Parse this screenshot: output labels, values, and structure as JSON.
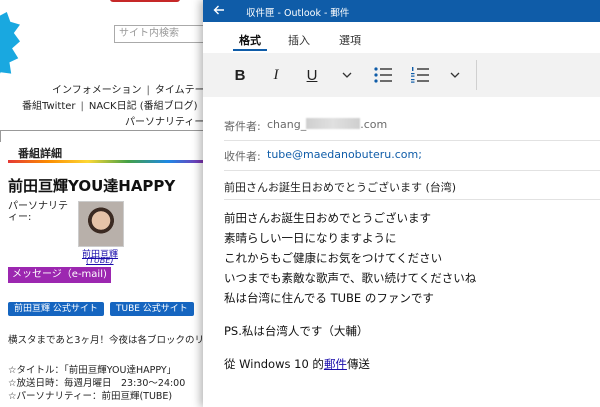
{
  "webpage": {
    "search_placeholder": "サイト内検索",
    "nav": {
      "row1": [
        "インフォメーション",
        "タイムテーブ"
      ],
      "row2": [
        "番組Twitter",
        "NACK日記 (番組ブログ)"
      ],
      "row3": [
        "パーソナリティー"
      ]
    },
    "section_title": "番組詳細",
    "program_title": "前田亘輝YOU達HAPPY",
    "personality_label": "パーソナリティー:",
    "host_name": "前田亘輝",
    "host_group": "(TUBE)",
    "message_button": "メッセージ（e-mail)",
    "site_buttons": [
      "前田亘輝 公式サイト",
      "TUBE 公式サイト"
    ],
    "intro_text": "横スタまであと3ヶ月！今夜は各ブロックのリ",
    "details": [
      "☆タイトル：「前田亘輝YOU達HAPPY」",
      "☆放送日時：毎週月曜日　23:30～24:00",
      "☆パーソナリティー：前田亘輝(TUBE)"
    ],
    "colors": {
      "badge": "#19a8e0",
      "message_button": "#9c27b0",
      "site_button": "#1565c0"
    }
  },
  "outlook": {
    "window_title": "収件匣 - Outlook - 郵件",
    "back_icon": "arrow-left-icon",
    "tabs": [
      {
        "label": "格式",
        "active": true
      },
      {
        "label": "插入",
        "active": false
      },
      {
        "label": "選項",
        "active": false
      }
    ],
    "toolbar": {
      "bold": "B",
      "italic": "I",
      "underline": "U",
      "icons": [
        "bold-icon",
        "italic-icon",
        "underline-icon",
        "chevron-down-icon",
        "bulleted-list-icon",
        "numbered-list-icon",
        "chevron-down-icon"
      ]
    },
    "from_label": "寄件者:",
    "from_prefix": "chang_",
    "from_suffix": ".com",
    "to_label": "收件者:",
    "to_value": "tube@maedanobuteru.com;",
    "subject": "前田さんお誕生日おめでとうございます (台湾)",
    "body_lines": [
      "前田さんお誕生日おめでとうございます",
      "素晴らしい一日になりますように",
      "これからもご健康にお気をつけてください",
      "いつまでも素敵な歌声で、歌い続けてくださいね",
      "私は台湾に住んでる TUBE のファンです"
    ],
    "ps_line": "PS.私は台湾人です（大輔）",
    "signature": {
      "before": "從 Windows 10 的",
      "link": "郵件",
      "after": "傳送"
    },
    "colors": {
      "titlebar": "#0f5ca8",
      "recipient": "#0f5ca8",
      "toolbar_bg": "#f2f2f2"
    }
  }
}
